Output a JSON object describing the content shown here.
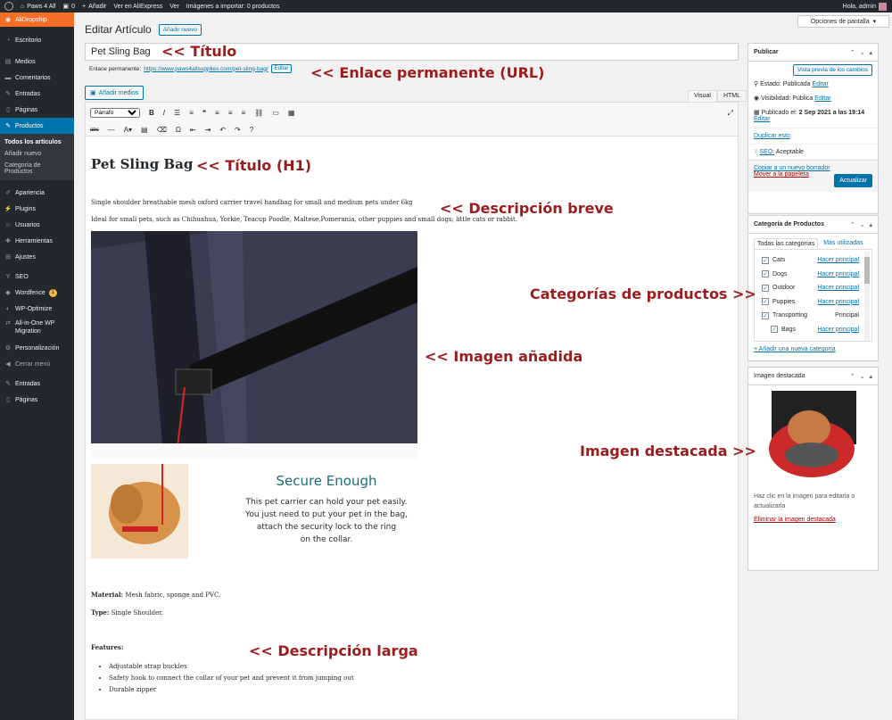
{
  "adminbar": {
    "site": "Paws 4 All",
    "comments": "0",
    "add": "Añadir",
    "aliexpress": "Ver en AliExpress",
    "view": "Ver",
    "import": "Imágenes a importar: 0 productos",
    "greeting": "Hola, admin"
  },
  "sidebar": {
    "aliDropship": "AliDropship",
    "items": [
      "Escritorio",
      "Medios",
      "Comentarios",
      "Entradas",
      "Páginas"
    ],
    "productos": "Productos",
    "sub": [
      "Todos los artículos",
      "Añadir nuevo",
      "Categoría de Productos"
    ],
    "items2": [
      "Apariencia",
      "Plugins",
      "Usuarios",
      "Herramientas",
      "Ajustes"
    ],
    "seo": "SEO",
    "wordfence": "Wordfence",
    "wordfenceBadge": "1",
    "wpoptimize": "WP-Optimize",
    "allinone": "All-in-One WP Migration",
    "personalizacion": "Personalización",
    "cerrar": "Cerrar menú",
    "entradas": "Entradas",
    "paginas": "Páginas"
  },
  "header": {
    "screenOptions": "Opciones de pantalla",
    "title": "Editar Artículo",
    "addNew": "Añadir nuevo"
  },
  "post": {
    "title": "Pet Sling Bag",
    "permalinkLabel": "Enlace permanente:",
    "permalinkUrl": "https://www.paws4allsupplies.com/pet-sling-bag/",
    "editBtn": "Editar"
  },
  "editor": {
    "addMedia": "Añadir medios",
    "tabVisual": "Visual",
    "tabHTML": "HTML",
    "format": "Párrafo"
  },
  "content": {
    "h1": "Pet Sling Bag",
    "short": "Single shoulder breathable mesh oxford carrier travel handbag for small and medium pets under 6kg",
    "ideal": "Ideal for small pets, such as Chihuahua, Yorkie, Teacup Poodle, Maltese,Pomerania, other puppies and small dogs; little cats or rabbit.",
    "secureTitle": "Secure Enough",
    "secureText": [
      "This pet carrier can hold your pet easily.",
      "You just need to put your pet in the bag,",
      "attach the security lock to the ring",
      "on the collar."
    ],
    "materialLabel": "Material:",
    "material": "Mesh fabric, sponge and PVC.",
    "typeLabel": "Type:",
    "type": "Single Shoulder.",
    "featuresLabel": "Features:",
    "features": [
      "Adjustable strap buckles",
      "Safety hook to connect the collar of your pet and prevent it from jumping out",
      "Durable zipper"
    ]
  },
  "annotations": {
    "titulo": "<< Título",
    "enlace": "<< Enlace permanente (URL)",
    "tituloH1": "<< Título (H1)",
    "descBreve": "<< Descripción breve",
    "categorias": "Categorías de productos >>",
    "imagenAnadida": "<< Imagen añadida",
    "imagenDestacada": "Imagen destacada >>",
    "descLarga": "<< Descripción larga"
  },
  "publish": {
    "title": "Publicar",
    "preview": "Vista previa de los cambios",
    "estadoLabel": "Estado:",
    "estado": "Publicada",
    "visLabel": "Visibilidad:",
    "vis": "Pública",
    "pubLabel": "Publicado el:",
    "pubDate": "2 Sep 2021 a las 19:14",
    "edit": "Editar",
    "duplicate": "Duplicar esto",
    "seoLabel": "SEO:",
    "seo": "Aceptable",
    "copy": "Copiar a un nuevo borrador",
    "trash": "Mover a la papelera",
    "update": "Actualizar"
  },
  "categories": {
    "title": "Categoría de Productos",
    "tabAll": "Todas las categorías",
    "tabUsed": "Más utilizadas",
    "items": [
      {
        "name": "Cats",
        "action": "Hacer principal"
      },
      {
        "name": "Dogs",
        "action": "Hacer principal"
      },
      {
        "name": "Outdoor",
        "action": "Hacer principal"
      },
      {
        "name": "Puppies",
        "action": "Hacer principal"
      },
      {
        "name": "Transporting",
        "action": "Principal"
      },
      {
        "name": "Bags",
        "action": "Hacer principal"
      }
    ],
    "addNew": "+ Añadir una nueva categoría"
  },
  "featured": {
    "title": "Imagen destacada",
    "help": "Haz clic en la imagen para editarla o actualizarla",
    "remove": "Eliminar la imagen destacada"
  },
  "colors": {
    "accent": "#0073aa",
    "annotation": "#9b1c1c",
    "brand": "#f56e28"
  }
}
